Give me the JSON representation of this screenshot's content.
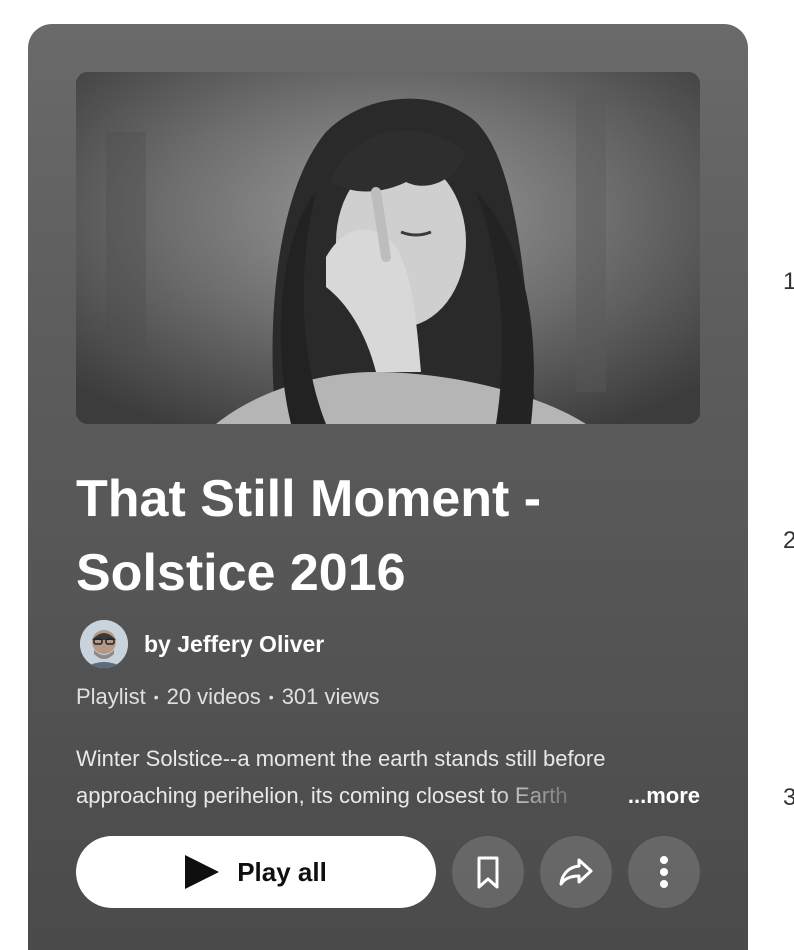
{
  "playlist": {
    "title_line1": "That Still Moment -",
    "title_line2": "Solstice 2016",
    "owner": "by Jeffery Oliver",
    "meta": {
      "type": "Playlist",
      "videos": "20 videos",
      "views": "301 views"
    },
    "description_line1": "Winter Solstice--a moment the earth stands still before",
    "description_line2": "approaching perihelion, its coming closest to Earth",
    "more_label": "...more"
  },
  "actions": {
    "play_all_label": "Play all",
    "icons": [
      "play-icon",
      "bookmark-icon",
      "share-icon",
      "more-vert-icon"
    ]
  },
  "side_list": {
    "indices": [
      "1",
      "2",
      "3"
    ]
  }
}
